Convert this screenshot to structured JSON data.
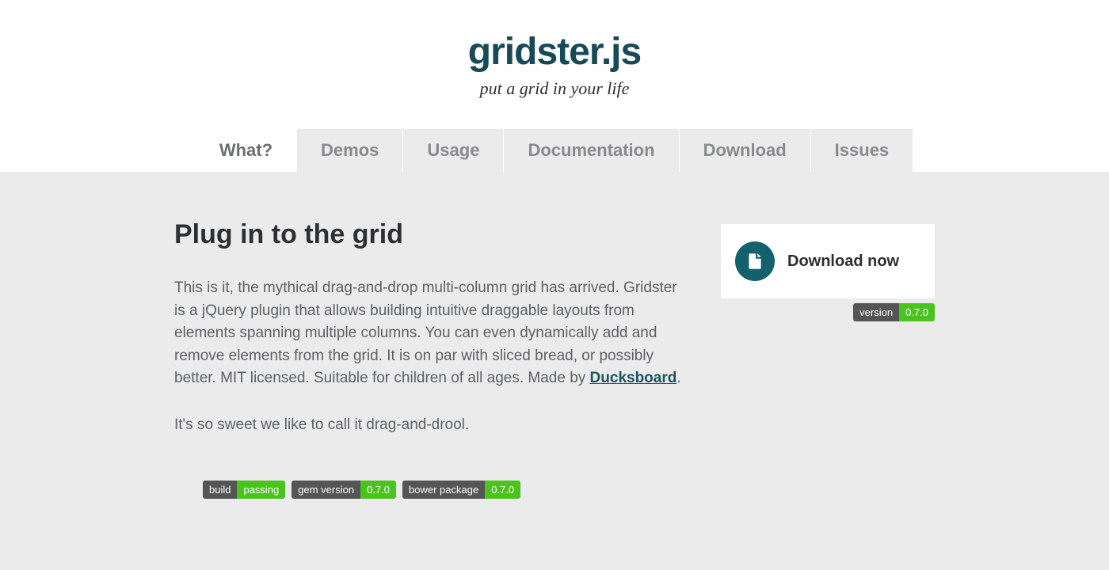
{
  "header": {
    "title": "gridster.js",
    "tagline": "put a grid in your life"
  },
  "nav": {
    "items": [
      {
        "label": "What?",
        "active": true
      },
      {
        "label": "Demos",
        "active": false
      },
      {
        "label": "Usage",
        "active": false
      },
      {
        "label": "Documentation",
        "active": false
      },
      {
        "label": "Download",
        "active": false
      },
      {
        "label": "Issues",
        "active": false
      }
    ]
  },
  "intro": {
    "heading": "Plug in to the grid",
    "p1_pre": "This is it, the mythical drag-and-drop multi-column grid has arrived. Gridster is a jQuery plugin that allows building intuitive draggable layouts from elements spanning multiple columns. You can even dynamically add and remove elements from the grid. It is on par with sliced bread, or possibly better. MIT licensed. Suitable for children of all ages. Made by ",
    "p1_link": "Ducksboard",
    "p1_post": ".",
    "p2": "It's so sweet we like to call it drag-and-drool."
  },
  "download": {
    "button_label": "Download now",
    "version_label": "version",
    "version_value": "0.7.0"
  },
  "badges": [
    {
      "left": "build",
      "right": "passing"
    },
    {
      "left": "gem version",
      "right": "0.7.0"
    },
    {
      "left": "bower package",
      "right": "0.7.0"
    }
  ]
}
